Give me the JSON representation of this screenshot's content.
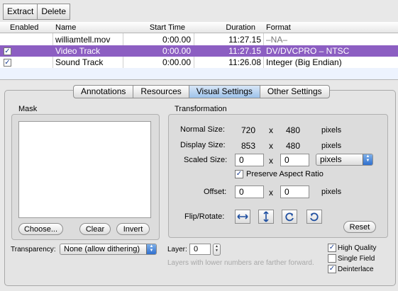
{
  "toolbar": {
    "extract_label": "Extract",
    "delete_label": "Delete"
  },
  "table": {
    "headers": {
      "enabled": "Enabled",
      "name": "Name",
      "start_time": "Start Time",
      "duration": "Duration",
      "format": "Format"
    },
    "rows": [
      {
        "enabled": null,
        "name": "williamtell.mov",
        "start_time": "0:00.00",
        "duration": "11:27.15",
        "format": "–NA–"
      },
      {
        "enabled": true,
        "name": "Video Track",
        "start_time": "0:00.00",
        "duration": "11:27.15",
        "format": "DV/DVCPRO – NTSC",
        "selected": true
      },
      {
        "enabled": true,
        "name": "Sound Track",
        "start_time": "0:00.00",
        "duration": "11:26.08",
        "format": "Integer (Big Endian)"
      }
    ]
  },
  "tabs": [
    "Annotations",
    "Resources",
    "Visual Settings",
    "Other Settings"
  ],
  "active_tab": "Visual Settings",
  "mask": {
    "title": "Mask",
    "choose_label": "Choose...",
    "clear_label": "Clear",
    "invert_label": "Invert"
  },
  "transformation": {
    "title": "Transformation",
    "normal_size_label": "Normal Size:",
    "normal_w": "720",
    "normal_h": "480",
    "display_size_label": "Display Size:",
    "display_w": "853",
    "display_h": "480",
    "scaled_size_label": "Scaled Size:",
    "scaled_w": "0",
    "scaled_h": "0",
    "units_option": "pixels",
    "pixels_label": "pixels",
    "times": "x",
    "preserve_label": "Preserve Aspect Ratio",
    "preserve_checked": true,
    "offset_label": "Offset:",
    "offset_x": "0",
    "offset_y": "0",
    "flip_label": "Flip/Rotate:",
    "reset_label": "Reset"
  },
  "transparency": {
    "label": "Transparency:",
    "value": "None (allow dithering)"
  },
  "layer": {
    "label": "Layer:",
    "value": "0",
    "hint": "Layers with lower numbers are farther forward."
  },
  "options": {
    "high_quality": {
      "label": "High Quality",
      "checked": true
    },
    "single_field": {
      "label": "Single Field",
      "checked": false
    },
    "deinterlace": {
      "label": "Deinterlace",
      "checked": true
    }
  },
  "colors": {
    "selection": "#8c5ec2",
    "active_tab": "#9ec3ea"
  }
}
